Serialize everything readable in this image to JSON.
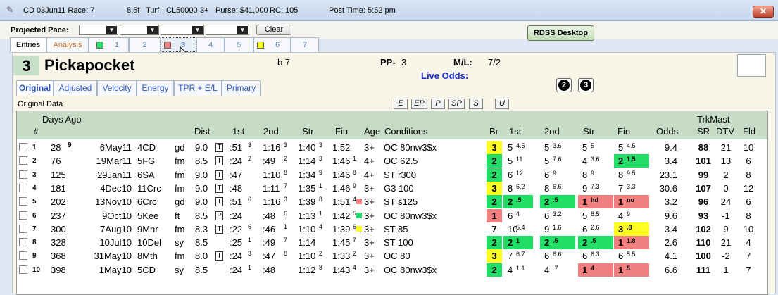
{
  "titlebar": {
    "race": "CD 03Jun11 Race: 7",
    "distance": "8.5f",
    "surface": "Turf",
    "class": "CL50000",
    "age": "3+",
    "purse": "Purse: $41,000",
    "rc": "RC: 105",
    "post_time": "Post Time: 5:52 pm",
    "close": "✕"
  },
  "pace": {
    "label": "Projected Pace:",
    "clear": "Clear"
  },
  "rdss": "RDSS Desktop",
  "tabs": [
    "Entries",
    "Analysis",
    "1",
    "2",
    "3",
    "4",
    "5",
    "6",
    "7"
  ],
  "horse": {
    "number": "3",
    "name": "Pickapocket",
    "sex_age": "b 7",
    "pp_label": "PP-",
    "pp": "3",
    "ml_label": "M/L:",
    "ml": "7/2",
    "live_odds": "Live Odds:"
  },
  "circles": [
    "2",
    "3"
  ],
  "subtabs": [
    "Original",
    "Adjusted",
    "Velocity",
    "Energy",
    "TPR + E/L",
    "Primary"
  ],
  "section_label": "Original Data",
  "filters": [
    "E",
    "EP",
    "P",
    "SP",
    "S",
    "U"
  ],
  "columns": {
    "days_ago": "Days Ago",
    "num": "#",
    "dist": "Dist",
    "first": "1st",
    "second": "2nd",
    "str": "Str",
    "fin": "Fin",
    "age": "Age",
    "conditions": "Conditions",
    "br": "Br",
    "c1": "1st",
    "c2": "2nd",
    "cstr": "Str",
    "cfin": "Fin",
    "odds": "Odds",
    "trkmast": "TrkMast",
    "sr": "SR",
    "dtv": "DTV",
    "fld": "Fld"
  },
  "colors": {
    "green": "#22dd66",
    "red": "#f08080",
    "yellow": "#ffff22",
    "header": "#c6dcc6"
  },
  "rows": [
    {
      "n": "1",
      "days": "28",
      "days_sup": "9",
      "date": "6May11",
      "trk": "4CD",
      "cond": "gd",
      "dist": "9.0",
      "surf": "T",
      "f1": ":51",
      "f1s": "3",
      "f2": "1:16",
      "f2s": "3",
      "fs": "1:40",
      "fss": "3",
      "ff": "1:52",
      "ffs": "",
      "age": "3+",
      "condition": "OC 80nw3$x",
      "br": "3",
      "brc": "yellow",
      "p1": "5",
      "p1s": "4.5",
      "p1c": "",
      "p2": "5",
      "p2s": "3.6",
      "p2c": "",
      "p3": "5",
      "p3s": "5",
      "p3c": "",
      "p4": "5",
      "p4s": "4.5",
      "p4c": "",
      "odds": "9.4",
      "sr": "88",
      "dtv": "21",
      "fld": "10",
      "dot": ""
    },
    {
      "n": "2",
      "days": "76",
      "days_sup": "",
      "date": "19Mar11",
      "trk": "5FG",
      "cond": "fm",
      "dist": "8.5",
      "surf": "T",
      "f1": ":24",
      "f1s": "2",
      "f2": ":49",
      "f2s": "2",
      "fs": "1:14",
      "fss": "3",
      "ff": "1:46",
      "ffs": "1",
      "age": "4+",
      "condition": "OC 62.5",
      "br": "2",
      "brc": "green",
      "p1": "5",
      "p1s": "11",
      "p1c": "",
      "p2": "5",
      "p2s": "7.6",
      "p2c": "",
      "p3": "4",
      "p3s": "3.6",
      "p3c": "",
      "p4": "2",
      "p4s": "1.5",
      "p4c": "green",
      "odds": "3.4",
      "sr": "101",
      "dtv": "13",
      "fld": "6",
      "dot": ""
    },
    {
      "n": "3",
      "days": "125",
      "days_sup": "",
      "date": "29Jan11",
      "trk": "6SA",
      "cond": "fm",
      "dist": "9.0",
      "surf": "T",
      "f1": ":47",
      "f1s": "",
      "f2": "1:10",
      "f2s": "8",
      "fs": "1:34",
      "fss": "9",
      "ff": "1:46",
      "ffs": "8",
      "age": "4+",
      "condition": "ST r300",
      "br": "2",
      "brc": "green",
      "p1": "6",
      "p1s": "12",
      "p1c": "",
      "p2": "6",
      "p2s": "9",
      "p2c": "",
      "p3": "8",
      "p3s": "9",
      "p3c": "",
      "p4": "8",
      "p4s": "9.5",
      "p4c": "",
      "odds": "23.1",
      "sr": "99",
      "dtv": "2",
      "fld": "8",
      "dot": ""
    },
    {
      "n": "4",
      "days": "181",
      "days_sup": "",
      "date": "4Dec10",
      "trk": "11Crc",
      "cond": "fm",
      "dist": "9.0",
      "surf": "T",
      "f1": ":48",
      "f1s": "",
      "f2": "1:11",
      "f2s": "7",
      "fs": "1:35",
      "fss": "1",
      "ff": "1:46",
      "ffs": "9",
      "age": "3+",
      "condition": "G3 100",
      "br": "3",
      "brc": "yellow",
      "p1": "8",
      "p1s": "6.2",
      "p1c": "",
      "p2": "8",
      "p2s": "6.6",
      "p2c": "",
      "p3": "9",
      "p3s": "7.3",
      "p3c": "",
      "p4": "7",
      "p4s": "3.3",
      "p4c": "",
      "odds": "30.6",
      "sr": "107",
      "dtv": "0",
      "fld": "12",
      "dot": ""
    },
    {
      "n": "5",
      "days": "202",
      "days_sup": "",
      "date": "13Nov10",
      "trk": "6Crc",
      "cond": "gd",
      "dist": "9.0",
      "surf": "T",
      "f1": ":51",
      "f1s": "6",
      "f2": "1:16",
      "f2s": "3",
      "fs": "1:39",
      "fss": "8",
      "ff": "1:51",
      "ffs": "4",
      "age": "3+",
      "condition": "ST s125",
      "br": "2",
      "brc": "green",
      "p1": "2",
      "p1s": ".5",
      "p1c": "green",
      "p2": "2",
      "p2s": ".5",
      "p2c": "green",
      "p3": "1",
      "p3s": "hd",
      "p3c": "red",
      "p4": "1",
      "p4s": "no",
      "p4c": "red",
      "odds": "3.2",
      "sr": "96",
      "dtv": "24",
      "fld": "6",
      "dot": "red"
    },
    {
      "n": "6",
      "days": "237",
      "days_sup": "",
      "date": "9Oct10",
      "trk": "5Kee",
      "cond": "ft",
      "dist": "8.5",
      "surf": "P",
      "f1": ":24",
      "f1s": "",
      "f2": ":48",
      "f2s": "6",
      "fs": "1:13",
      "fss": "1",
      "ff": "1:42",
      "ffs": "5",
      "age": "3+",
      "condition": "OC 80nw3$x",
      "br": "1",
      "brc": "red",
      "p1": "6",
      "p1s": "4",
      "p1c": "",
      "p2": "6",
      "p2s": "3.2",
      "p2c": "",
      "p3": "5",
      "p3s": "8.5",
      "p3c": "",
      "p4": "4",
      "p4s": "9",
      "p4c": "",
      "odds": "9.6",
      "sr": "93",
      "dtv": "-1",
      "fld": "8",
      "dot": "green"
    },
    {
      "n": "7",
      "days": "300",
      "days_sup": "",
      "date": "7Aug10",
      "trk": "9Mnr",
      "cond": "fm",
      "dist": "8.3",
      "surf": "T",
      "f1": ":22",
      "f1s": "6",
      "f2": ":46",
      "f2s": "1",
      "fs": "1:10",
      "fss": "4",
      "ff": "1:39",
      "ffs": "6",
      "age": "3+",
      "condition": "ST 85",
      "br": "7",
      "brc": "",
      "p1": "10",
      "p1s": "5.4",
      "p1c": "",
      "p2": "9",
      "p2s": "1.6",
      "p2c": "",
      "p3": "6",
      "p3s": "2.6",
      "p3c": "",
      "p4": "3",
      "p4s": ".8",
      "p4c": "yellow",
      "odds": "3.4",
      "sr": "102",
      "dtv": "9",
      "fld": "10",
      "dot": "yellow"
    },
    {
      "n": "8",
      "days": "328",
      "days_sup": "",
      "date": "10Jul10",
      "trk": "10Del",
      "cond": "sy",
      "dist": "8.5",
      "surf": "",
      "f1": ":25",
      "f1s": "1",
      "f2": ":49",
      "f2s": "7",
      "fs": "1:14",
      "fss": "",
      "ff": "1:45",
      "ffs": "7",
      "age": "3+",
      "condition": "ST 100",
      "br": "2",
      "brc": "green",
      "p1": "2",
      "p1s": "1",
      "p1c": "green",
      "p2": "2",
      "p2s": ".5",
      "p2c": "green",
      "p3": "2",
      "p3s": ".5",
      "p3c": "green",
      "p4": "1",
      "p4s": "1.8",
      "p4c": "red",
      "odds": "2.6",
      "sr": "110",
      "dtv": "21",
      "fld": "4",
      "dot": ""
    },
    {
      "n": "9",
      "days": "368",
      "days_sup": "",
      "date": "31May10",
      "trk": "8Mth",
      "cond": "fm",
      "dist": "8.0",
      "surf": "T",
      "f1": ":24",
      "f1s": "3",
      "f2": ":47",
      "f2s": "8",
      "fs": "1:10",
      "fss": "2",
      "ff": "1:33",
      "ffs": "2",
      "age": "3+",
      "condition": "OC 80",
      "br": "3",
      "brc": "yellow",
      "p1": "7",
      "p1s": "6.7",
      "p1c": "",
      "p2": "6",
      "p2s": "6.6",
      "p2c": "",
      "p3": "6",
      "p3s": "6.3",
      "p3c": "",
      "p4": "6",
      "p4s": "5.5",
      "p4c": "",
      "odds": "4.1",
      "sr": "100",
      "dtv": "-2",
      "fld": "7",
      "dot": ""
    },
    {
      "n": "10",
      "days": "398",
      "days_sup": "",
      "date": "1May10",
      "trk": "5CD",
      "cond": "sy",
      "dist": "8.5",
      "surf": "",
      "f1": ":24",
      "f1s": "1",
      "f2": ":48",
      "f2s": "",
      "fs": "1:12",
      "fss": "8",
      "ff": "1:43",
      "ffs": "4",
      "age": "3+",
      "condition": "OC 80nw3$x",
      "br": "2",
      "brc": "green",
      "p1": "4",
      "p1s": "1.1",
      "p1c": "",
      "p2": "4",
      "p2s": ".7",
      "p2c": "",
      "p3": "1",
      "p3s": "4",
      "p3c": "red",
      "p4": "1",
      "p4s": "5",
      "p4c": "red",
      "odds": "6.6",
      "sr": "111",
      "dtv": "1",
      "fld": "7",
      "dot": ""
    }
  ]
}
